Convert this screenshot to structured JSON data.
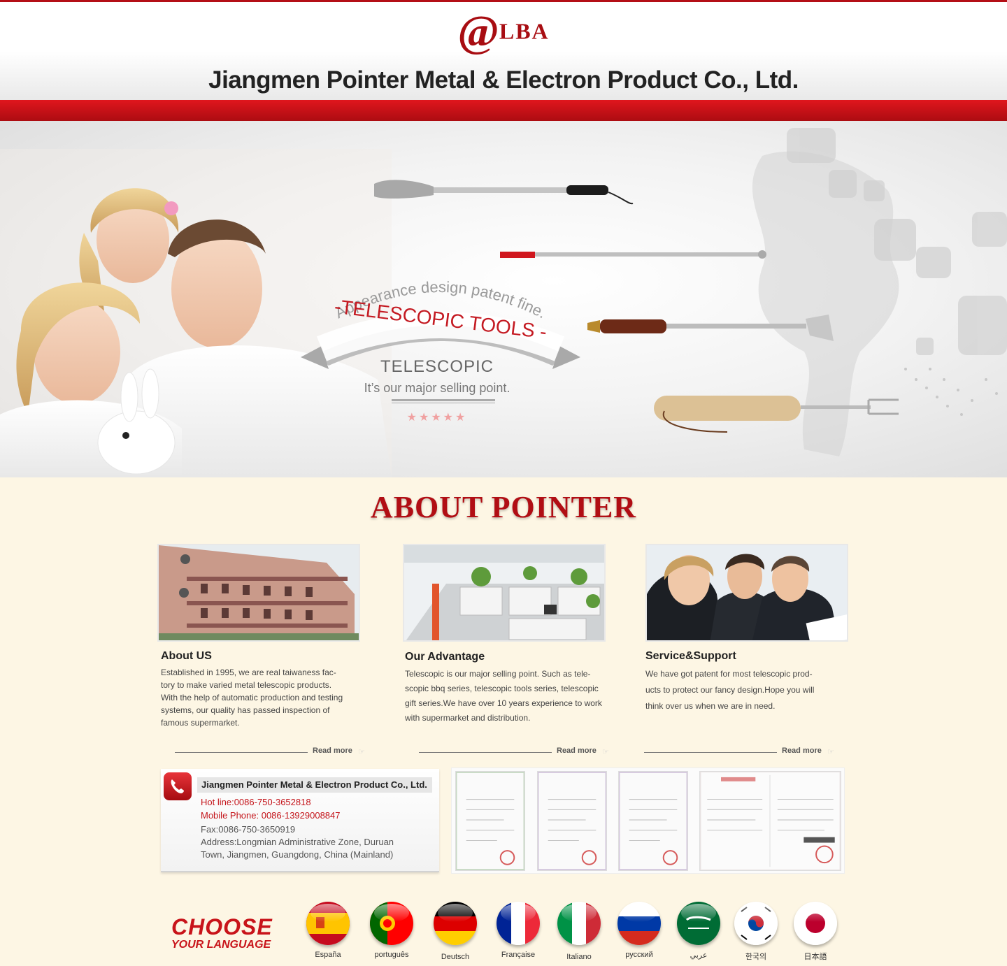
{
  "header": {
    "logo_at": "@",
    "logo_text": "LBA",
    "company_name": "Jiangmen Pointer Metal & Electron Product Co., Ltd."
  },
  "hero": {
    "tagline": "Appearance design patent fine.",
    "ribbon": "-TELESCOPIC TOOLS -",
    "subtitle": "TELESCOPIC",
    "selling_point": "It’s our major selling point.",
    "stars": "★★★★★"
  },
  "about": {
    "title": "ABOUT POINTER",
    "cards": [
      {
        "heading": "About US",
        "text_lines": [
          "Established in 1995, we are real taiwaness fac-",
          "tory to make varied metal telescopic products.",
          "With the help of automatic production and testing",
          "systems, our quality has passed inspection of",
          "famous supermarket."
        ],
        "read_more": "Read more"
      },
      {
        "heading": "Our Advantage",
        "text_lines": [
          "Telescopic is our major selling point. Such as tele-",
          "scopic bbq series, telescopic tools series, telescopic",
          "gift series.We have over 10 years experience to work",
          "with supermarket and distribution."
        ],
        "read_more": "Read more"
      },
      {
        "heading": "Service&Support",
        "text_lines": [
          "We have got patent for most telescopic prod-",
          "ucts to protect our fancy design.Hope you will",
          "think over us when we are in need."
        ],
        "read_more": "Read more"
      }
    ]
  },
  "contact": {
    "company": "Jiangmen Pointer Metal & Electron Product Co., Ltd.",
    "hotline": "Hot line:0086-750-3652818",
    "mobile": "Mobile Phone: 0086-13929008847",
    "fax": "Fax:0086-750-3650919",
    "address_1": "Address:Longmian Administrative Zone, Duruan",
    "address_2": "Town, Jiangmen, Guangdong, China (Mainland)"
  },
  "language": {
    "choose": "CHOOSE",
    "your_language": "YOUR LANGUAGE",
    "options": [
      {
        "label": "España",
        "icon": "spain-flag-icon"
      },
      {
        "label": "português",
        "icon": "portugal-flag-icon"
      },
      {
        "label": "Deutsch",
        "icon": "germany-flag-icon"
      },
      {
        "label": "Française",
        "icon": "france-flag-icon"
      },
      {
        "label": "Italiano",
        "icon": "italy-flag-icon"
      },
      {
        "label": "русский",
        "icon": "russia-flag-icon"
      },
      {
        "label": "عربي",
        "icon": "saudi-arabia-flag-icon"
      },
      {
        "label": "한국의",
        "icon": "korea-flag-icon"
      },
      {
        "label": "日本語",
        "icon": "japan-flag-icon"
      }
    ]
  },
  "colors": {
    "brand_red": "#b10e14",
    "background": "#fdf6e4"
  }
}
